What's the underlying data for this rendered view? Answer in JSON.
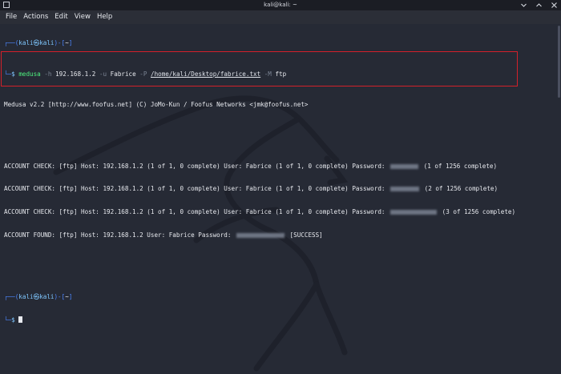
{
  "window": {
    "title": "kali@kali: ~"
  },
  "menu": [
    "File",
    "Actions",
    "Edit",
    "View",
    "Help"
  ],
  "prompt1": {
    "open": "┌──(",
    "user": "kali",
    "at": "㉿",
    "host": "kali",
    "close": ")-[",
    "dir": "~",
    "end": "]",
    "line2": "└─",
    "dollar": "$"
  },
  "command": {
    "prog": "medusa",
    "h_flag": "-h",
    "host": "192.168.1.2",
    "u_flag": "-u",
    "user": "Fabrice",
    "P_flag": "-P",
    "file": "/home/kali/Desktop/fabrice.txt",
    "M_flag": "-M",
    "module": "ftp"
  },
  "banner": "Medusa v2.2 [http://www.foofus.net] (C) JoMo-Kun / Foofus Networks <jmk@foofus.net>",
  "output": [
    {
      "prefix": "ACCOUNT CHECK: [ftp] Host: 192.168.1.2 (1 of 1, 0 complete) User: Fabrice (1 of 1, 0 complete) Password:",
      "suffix": "(1 of 1256 complete)"
    },
    {
      "prefix": "ACCOUNT CHECK: [ftp] Host: 192.168.1.2 (1 of 1, 0 complete) User: Fabrice (1 of 1, 0 complete) Password:",
      "suffix": "(2 of 1256 complete)"
    },
    {
      "prefix": "ACCOUNT CHECK: [ftp] Host: 192.168.1.2 (1 of 1, 0 complete) User: Fabrice (1 of 1, 0 complete) Password:",
      "suffix": "(3 of 1256 complete)"
    },
    {
      "prefix": "ACCOUNT FOUND: [ftp] Host: 192.168.1.2 User: Fabrice Password:",
      "suffix": "[SUCCESS]"
    }
  ],
  "colors": {
    "prompt_blue": "#4c86ff",
    "box_red": "#d3202a",
    "bg": "#262a35"
  },
  "icons": [
    "terminal-app-icon",
    "minimize-icon",
    "maximize-icon",
    "close-icon"
  ]
}
